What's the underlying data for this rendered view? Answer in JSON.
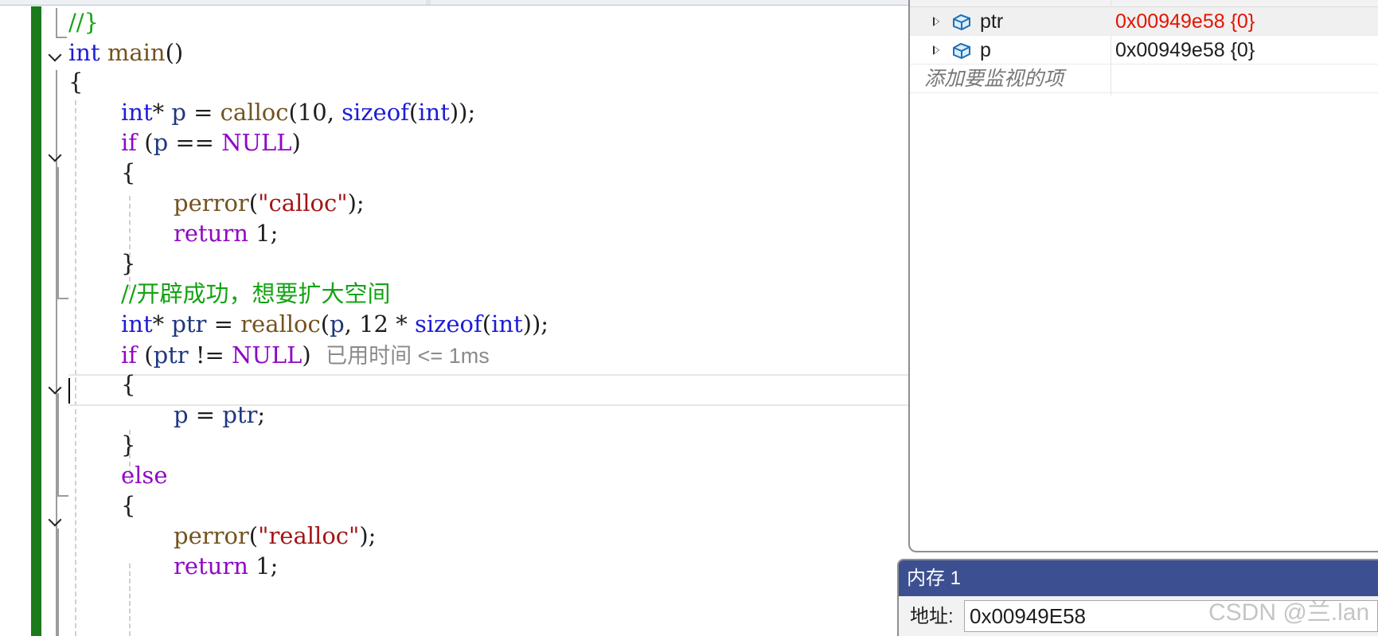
{
  "editor": {
    "lines": [
      {
        "id": "l0",
        "tokens": [
          {
            "c": "cmt",
            "t": "//}"
          }
        ]
      },
      {
        "id": "l1",
        "tokens": [
          {
            "c": "kw",
            "t": "int"
          },
          {
            "c": "punct",
            "t": " "
          },
          {
            "c": "fn",
            "t": "main"
          },
          {
            "c": "punct",
            "t": "()"
          }
        ]
      },
      {
        "id": "l2",
        "tokens": [
          {
            "c": "punct",
            "t": "{"
          }
        ]
      },
      {
        "id": "l3",
        "tokens": [
          {
            "c": "kw",
            "t": "int"
          },
          {
            "c": "punct",
            "t": "* "
          },
          {
            "c": "var",
            "t": "p"
          },
          {
            "c": "punct",
            "t": " = "
          },
          {
            "c": "fn",
            "t": "calloc"
          },
          {
            "c": "punct",
            "t": "("
          },
          {
            "c": "num",
            "t": "10"
          },
          {
            "c": "punct",
            "t": ", "
          },
          {
            "c": "kw",
            "t": "sizeof"
          },
          {
            "c": "punct",
            "t": "("
          },
          {
            "c": "kw",
            "t": "int"
          },
          {
            "c": "punct",
            "t": "));"
          }
        ]
      },
      {
        "id": "l4",
        "tokens": [
          {
            "c": "mac",
            "t": "if"
          },
          {
            "c": "punct",
            "t": " ("
          },
          {
            "c": "var",
            "t": "p"
          },
          {
            "c": "punct",
            "t": " == "
          },
          {
            "c": "mac",
            "t": "NULL"
          },
          {
            "c": "punct",
            "t": ")"
          }
        ]
      },
      {
        "id": "l5",
        "tokens": [
          {
            "c": "punct",
            "t": "{"
          }
        ]
      },
      {
        "id": "l6",
        "tokens": [
          {
            "c": "fn",
            "t": "perror"
          },
          {
            "c": "punct",
            "t": "("
          },
          {
            "c": "str",
            "t": "\"calloc\""
          },
          {
            "c": "punct",
            "t": ");"
          }
        ]
      },
      {
        "id": "l7",
        "tokens": [
          {
            "c": "mac",
            "t": "return"
          },
          {
            "c": "punct",
            "t": " "
          },
          {
            "c": "num",
            "t": "1"
          },
          {
            "c": "punct",
            "t": ";"
          }
        ]
      },
      {
        "id": "l8",
        "tokens": [
          {
            "c": "punct",
            "t": "}"
          }
        ]
      },
      {
        "id": "l9",
        "tokens": [
          {
            "c": "cmt",
            "t": "//开辟成功，想要扩大空间"
          }
        ]
      },
      {
        "id": "l10",
        "tokens": [
          {
            "c": "kw",
            "t": "int"
          },
          {
            "c": "punct",
            "t": "* "
          },
          {
            "c": "var",
            "t": "ptr"
          },
          {
            "c": "punct",
            "t": " = "
          },
          {
            "c": "fn",
            "t": "realloc"
          },
          {
            "c": "punct",
            "t": "("
          },
          {
            "c": "var",
            "t": "p"
          },
          {
            "c": "punct",
            "t": ", "
          },
          {
            "c": "num",
            "t": "12"
          },
          {
            "c": "punct",
            "t": " * "
          },
          {
            "c": "kw",
            "t": "sizeof"
          },
          {
            "c": "punct",
            "t": "("
          },
          {
            "c": "kw",
            "t": "int"
          },
          {
            "c": "punct",
            "t": "));"
          }
        ]
      },
      {
        "id": "l11",
        "tokens": [
          {
            "c": "mac",
            "t": "if"
          },
          {
            "c": "punct",
            "t": " ("
          },
          {
            "c": "var",
            "t": "ptr"
          },
          {
            "c": "punct",
            "t": " != "
          },
          {
            "c": "mac",
            "t": "NULL"
          },
          {
            "c": "punct",
            "t": ")"
          }
        ]
      },
      {
        "id": "l12",
        "tokens": [
          {
            "c": "punct",
            "t": "{"
          }
        ]
      },
      {
        "id": "l13",
        "tokens": [
          {
            "c": "var",
            "t": "p"
          },
          {
            "c": "punct",
            "t": " = "
          },
          {
            "c": "var",
            "t": "ptr"
          },
          {
            "c": "punct",
            "t": ";"
          }
        ]
      },
      {
        "id": "l14",
        "tokens": [
          {
            "c": "punct",
            "t": "}"
          }
        ]
      },
      {
        "id": "l15",
        "tokens": [
          {
            "c": "mac",
            "t": "else"
          }
        ]
      },
      {
        "id": "l16",
        "tokens": [
          {
            "c": "punct",
            "t": "{"
          }
        ]
      },
      {
        "id": "l17",
        "tokens": [
          {
            "c": "fn",
            "t": "perror"
          },
          {
            "c": "punct",
            "t": "("
          },
          {
            "c": "str",
            "t": "\"realloc\""
          },
          {
            "c": "punct",
            "t": ");"
          }
        ]
      },
      {
        "id": "l18",
        "tokens": [
          {
            "c": "mac",
            "t": "return"
          },
          {
            "c": "punct",
            "t": " "
          },
          {
            "c": "num",
            "t": "1"
          },
          {
            "c": "punct",
            "t": ";"
          }
        ]
      }
    ],
    "elapsed_hint": "已用时间 <= 1ms"
  },
  "watch": {
    "rows": [
      {
        "name": "ptr",
        "value": "0x00949e58 {0}",
        "changed": true,
        "icon": "variable-icon"
      },
      {
        "name": "p",
        "value": "0x00949e58 {0}",
        "changed": false,
        "icon": "variable-icon"
      }
    ],
    "add_item_placeholder": "添加要监视的项"
  },
  "memory": {
    "title": "内存 1",
    "address_label": "地址:",
    "address_value": "0x00949E58"
  },
  "watermark": "CSDN @兰.lan",
  "colors": {
    "change_bar": "#1b7a1b",
    "changed_value": "#e51400",
    "memory_titlebar": "#3c4f91"
  }
}
